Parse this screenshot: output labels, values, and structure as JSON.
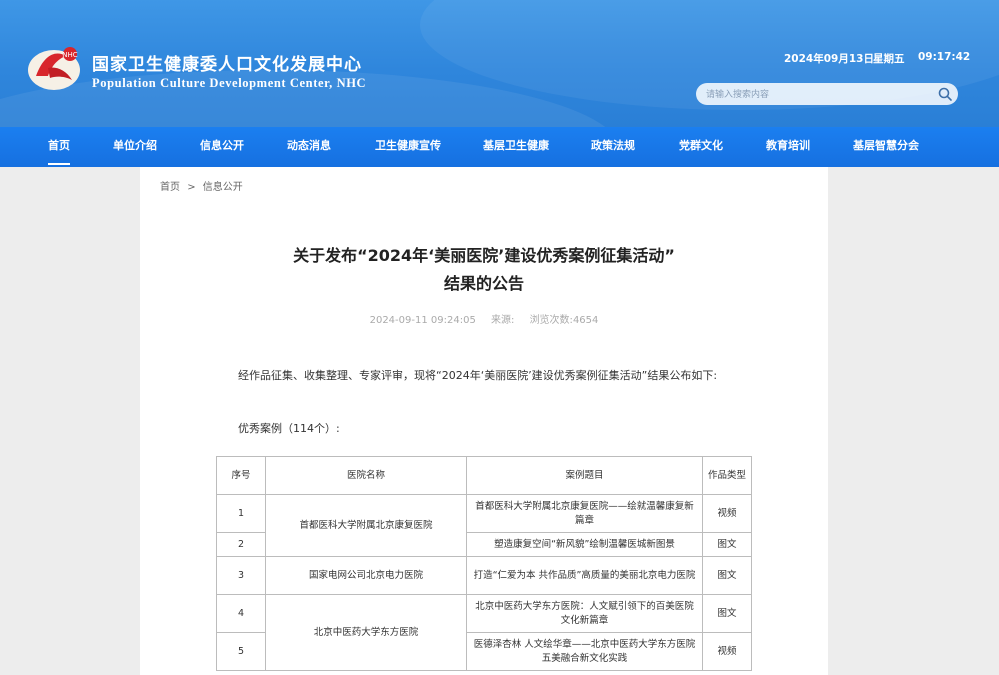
{
  "header": {
    "title_cn": "国家卫生健康委人口文化发展中心",
    "title_en": "Population Culture Development Center, NHC",
    "date": "2024年09月13日",
    "weekday": "星期五",
    "time": "09:17:42",
    "search_placeholder": "请输入搜索内容",
    "colors": {
      "header_bg": "#2f86dc",
      "nav_bg": "#1a73e8"
    }
  },
  "nav": {
    "items": [
      {
        "label": "首页"
      },
      {
        "label": "单位介绍"
      },
      {
        "label": "信息公开"
      },
      {
        "label": "动态消息"
      },
      {
        "label": "卫生健康宣传"
      },
      {
        "label": "基层卫生健康"
      },
      {
        "label": "政策法规"
      },
      {
        "label": "党群文化"
      },
      {
        "label": "教育培训"
      },
      {
        "label": "基层智慧分会"
      }
    ],
    "active": "首页"
  },
  "breadcrumb": {
    "home": "首页",
    "separator": ">",
    "current": "信息公开"
  },
  "article": {
    "title_line1": "关于发布“2024年‘美丽医院’建设优秀案例征集活动”",
    "title_line2": "结果的公告",
    "publish_time": "2024-09-11 09:24:05",
    "source_label": "来源:",
    "views_label": "浏览次数:",
    "views": "4654",
    "intro": "经作品征集、收集整理、专家评审，现将“2024年‘美丽医院’建设优秀案例征集活动”结果公布如下:",
    "section_label": "优秀案例（114个）:"
  },
  "table": {
    "headers": [
      "序号",
      "医院名称",
      "案例题目",
      "作品类型"
    ],
    "rows": [
      {
        "no": "1",
        "hospital": "首都医科大学附属北京康复医院",
        "case": "首都医科大学附属北京康复医院——绘就温馨康复新篇章",
        "type": "视频"
      },
      {
        "no": "2",
        "hospital": "",
        "case": "塑造康复空间“新风貌”绘制温馨医城新图景",
        "type": "图文"
      },
      {
        "no": "3",
        "hospital": "国家电网公司北京电力医院",
        "case": "打造“仁爱为本 共作品质”高质量的美丽北京电力医院",
        "type": "图文"
      },
      {
        "no": "4",
        "hospital": "北京中医药大学东方医院",
        "case": "北京中医药大学东方医院：人文赋引领下的百美医院文化新篇章",
        "type": "图文"
      },
      {
        "no": "5",
        "hospital": "",
        "case": "医德泽杏林 人文绘华章——北京中医药大学东方医院五美融合新文化实践",
        "type": "视频"
      }
    ]
  }
}
